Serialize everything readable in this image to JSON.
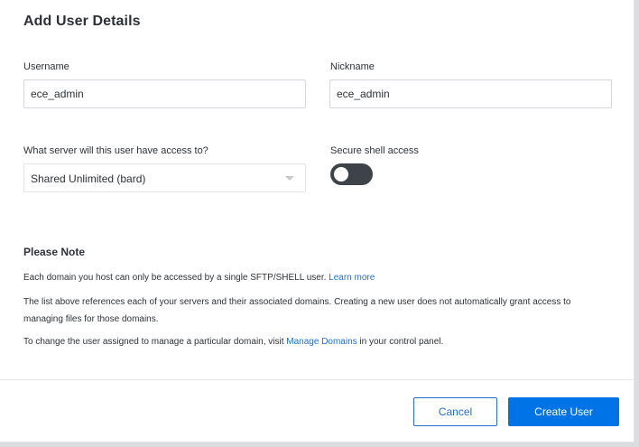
{
  "dialog": {
    "title": "Add User Details"
  },
  "form": {
    "username": {
      "label": "Username",
      "value": "ece_admin"
    },
    "nickname": {
      "label": "Nickname",
      "value": "ece_admin"
    },
    "server": {
      "label": "What server will this user have access to?",
      "selected": "Shared Unlimited (bard)"
    },
    "ssh": {
      "label": "Secure shell access",
      "enabled": false
    }
  },
  "note": {
    "title": "Please Note",
    "p1_text": "Each domain you host can only be accessed by a single SFTP/SHELL user. ",
    "p1_link": "Learn more",
    "p2_text": "The list above references each of your servers and their associated domains. Creating a new user does not automatically grant access to managing files for those domains.",
    "p3_before": "To change the user assigned to manage a particular domain, visit ",
    "p3_link": "Manage Domains",
    "p3_after": " in your control panel."
  },
  "actions": {
    "cancel_label": "Cancel",
    "create_label": "Create User"
  },
  "colors": {
    "accent": "#0073e6",
    "link": "#1f6fd6",
    "toggle_off": "#3e4349"
  }
}
